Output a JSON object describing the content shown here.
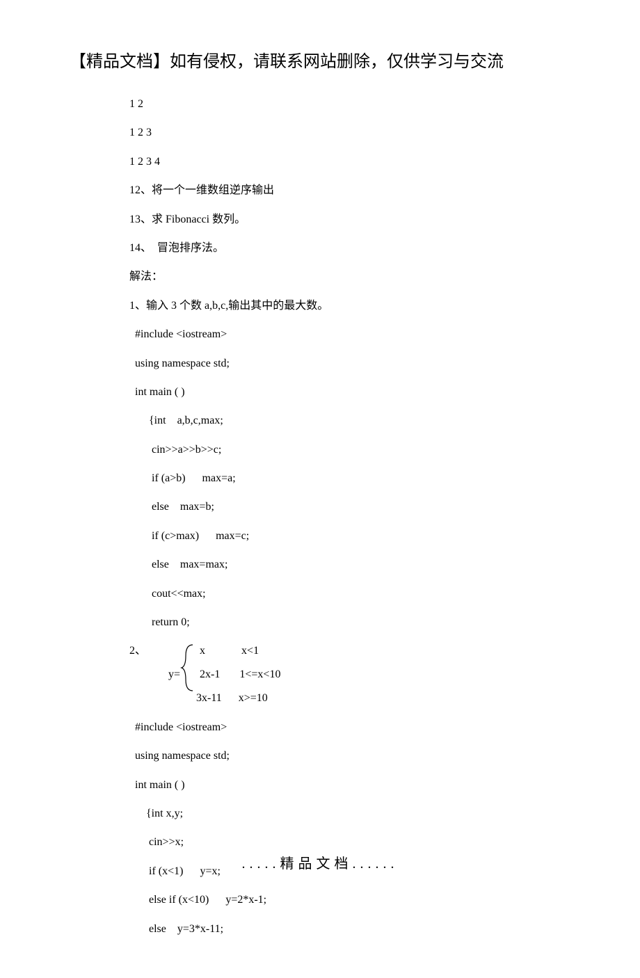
{
  "title": "【精品文档】如有侵权，请联系网站删除，仅供学习与交流",
  "lines": {
    "l1": "1 2",
    "l2": "1 2 3",
    "l3": "1 2 3 4",
    "l4": "12、将一个一维数组逆序输出",
    "l5": "13、求 Fibonacci 数列。",
    "l6": "14、  冒泡排序法。",
    "l7": "解法：",
    "l8": "1、输入 3 个数 a,b,c,输出其中的最大数。",
    "l9": "  #include <iostream>",
    "l10": "  using namespace std;",
    "l11": "  int main ( )",
    "l12": "       {int    a,b,c,max;",
    "l13": "        cin>>a>>b>>c;",
    "l14": "        if (a>b)      max=a;",
    "l15": "        else    max=b;",
    "l16": "        if (c>max)      max=c;",
    "l17": "        else    max=max;",
    "l18": "        cout<<max;",
    "l19": "        return 0;",
    "l20_prefix": "2、",
    "l20_y": "        y=",
    "brace_row1": "x             x<1",
    "brace_row2": "2x-1       1<=x<10",
    "brace_row3": "                        3x-11      x>=10",
    "l23": "  #include <iostream>",
    "l24": "  using namespace std;",
    "l25": "  int main ( )",
    "l26": "      {int x,y;",
    "l27": "       cin>>x;",
    "l28": "       if (x<1)      y=x;",
    "l29": "       else if (x<10)      y=2*x-1;",
    "l30": "       else    y=3*x-11;"
  },
  "footer": ".....精品文档......"
}
